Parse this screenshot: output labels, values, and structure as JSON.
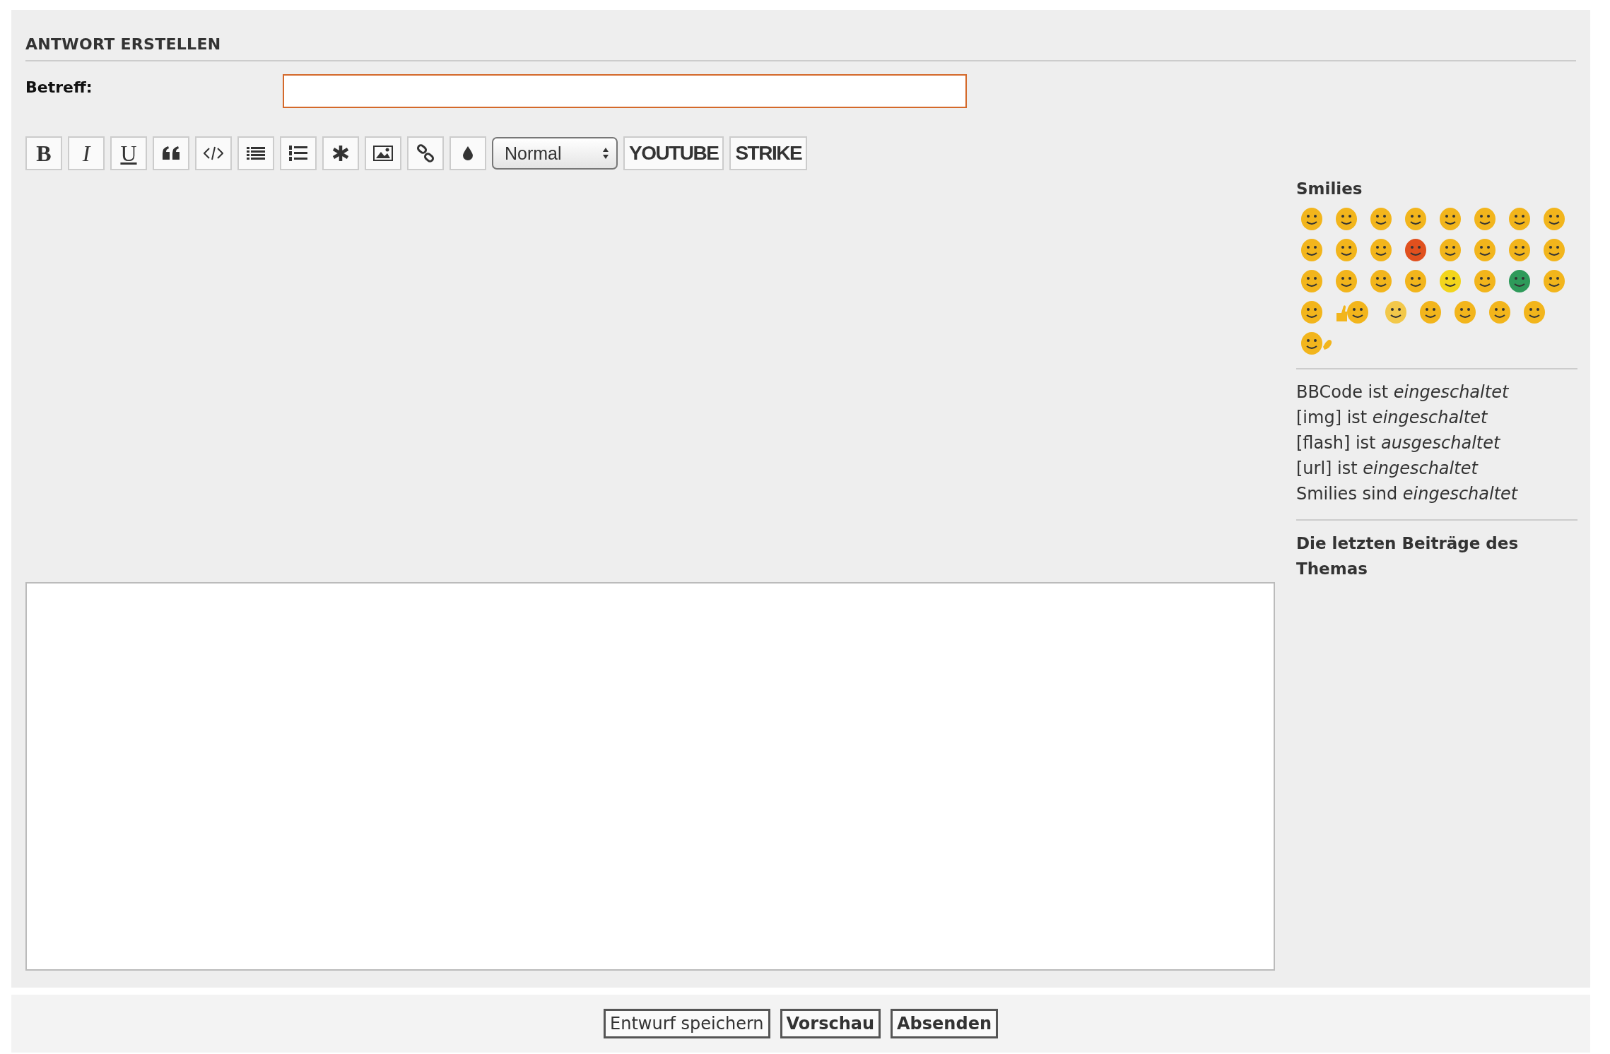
{
  "form": {
    "title": "ANTWORT ERSTELLEN",
    "subject": {
      "label": "Betreff:"
    },
    "toolbar": [
      {
        "kind": "text",
        "label": "B"
      },
      {
        "kind": "text",
        "label": "I"
      },
      {
        "kind": "text",
        "label": "U"
      },
      {
        "kind": "icon"
      },
      {
        "kind": "icon"
      },
      {
        "kind": "icon"
      },
      {
        "kind": "icon"
      },
      {
        "kind": "icon"
      },
      {
        "kind": "icon"
      },
      {
        "kind": "icon"
      },
      {
        "kind": "icon"
      },
      {
        "kind": "select",
        "value": "Normal"
      },
      {
        "kind": "text",
        "label": "YOUTUBE"
      },
      {
        "kind": "text",
        "label": "STRIKE"
      }
    ]
  },
  "sidebar": {
    "smilies_title": "Smilies",
    "smilies": [
      {
        "kind": "face",
        "color": "#f2b51c"
      },
      {
        "kind": "face",
        "color": "#f2b51c"
      },
      {
        "kind": "face",
        "color": "#f2b51c"
      },
      {
        "kind": "face",
        "color": "#f2b51c"
      },
      {
        "kind": "face",
        "color": "#f2b51c"
      },
      {
        "kind": "face",
        "color": "#f2b51c"
      },
      {
        "kind": "face",
        "color": "#f2b51c"
      },
      {
        "kind": "face",
        "color": "#f2b51c"
      },
      {
        "kind": "face",
        "color": "#f2b51c"
      },
      {
        "kind": "face",
        "color": "#f2b51c"
      },
      {
        "kind": "face",
        "color": "#f2b51c"
      },
      {
        "kind": "face",
        "color": "#e0501e"
      },
      {
        "kind": "face",
        "color": "#f2b51c"
      },
      {
        "kind": "face",
        "color": "#f2b51c"
      },
      {
        "kind": "face",
        "color": "#f2b51c"
      },
      {
        "kind": "face",
        "color": "#f2b51c"
      },
      {
        "kind": "face",
        "color": "#f2b51c"
      },
      {
        "kind": "face",
        "color": "#f2b51c"
      },
      {
        "kind": "face",
        "color": "#f2b51c"
      },
      {
        "kind": "face",
        "color": "#f2b51c"
      },
      {
        "kind": "face",
        "color": "#f2d51c"
      },
      {
        "kind": "face",
        "color": "#f2b51c"
      },
      {
        "kind": "face",
        "color": "#2e9a5a"
      },
      {
        "kind": "face",
        "color": "#f2b51c"
      },
      {
        "kind": "face",
        "color": "#f2b51c"
      },
      {
        "kind": "thumb",
        "color": "#f2b51c"
      },
      {
        "kind": "face",
        "color": "#f2c84a"
      },
      {
        "kind": "face",
        "color": "#f2b51c"
      },
      {
        "kind": "face",
        "color": "#f2b51c"
      },
      {
        "kind": "face",
        "color": "#f2b51c"
      },
      {
        "kind": "face",
        "color": "#f2b51c"
      },
      {
        "kind": "wave",
        "color": "#f2b51c"
      }
    ],
    "status": [
      "BBCode ist *eingeschaltet*",
      "[img] ist *eingeschaltet*",
      "[flash] ist *ausgeschaltet*",
      "[url] ist *eingeschaltet*",
      "Smilies sind *eingeschaltet*"
    ],
    "recent_title": "Die letzten Beiträge des Themas"
  },
  "buttons": [
    {
      "label": "Entwurf speichern",
      "emphasized": false
    },
    {
      "label": "Vorschau",
      "emphasized": true
    },
    {
      "label": "Absenden",
      "emphasized": true
    }
  ]
}
